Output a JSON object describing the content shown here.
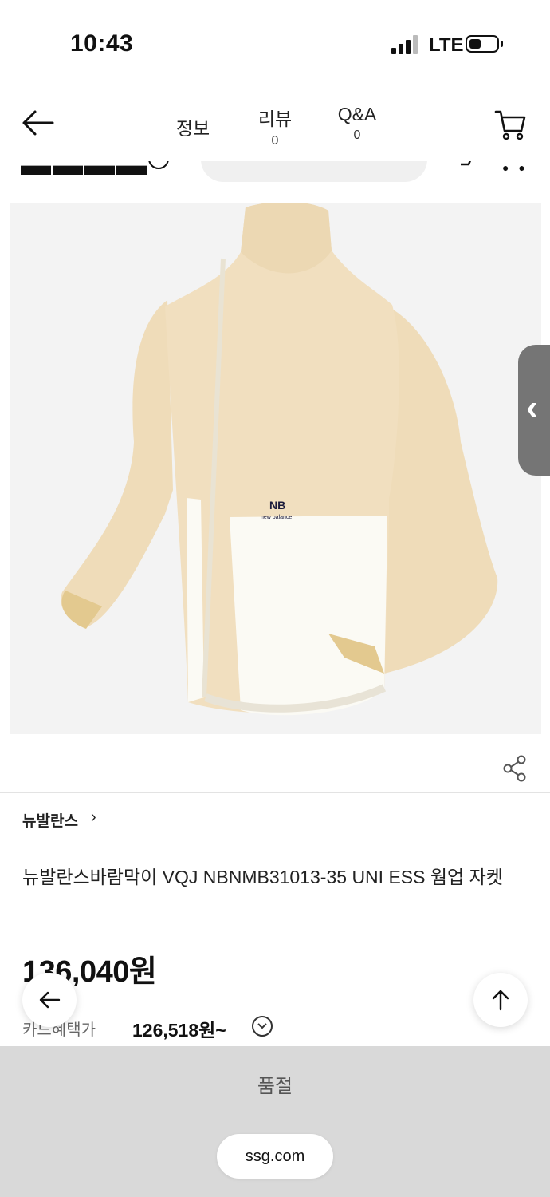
{
  "status_bar": {
    "time": "10:43",
    "network": "LTE"
  },
  "header": {
    "tabs": [
      {
        "label": "정보",
        "count": ""
      },
      {
        "label": "리뷰",
        "count": "0"
      },
      {
        "label": "Q&A",
        "count": "0"
      }
    ],
    "icons": {
      "back": "back-arrow-icon",
      "cart": "cart-icon"
    }
  },
  "product": {
    "brand": "뉴발란스",
    "title": "뉴발란스바람막이 VQJ NBNMB31013-35 UNI ESS 웜업 자켓",
    "price": "136,040원",
    "card_label": "카드혜택가",
    "card_price": "126,518원~",
    "image_colors": {
      "beige": "#f1dfbf",
      "white": "#fbfaf4",
      "background": "#f3f3f3"
    }
  },
  "actions": {
    "sold_out": "품절",
    "url": "ssg.com"
  },
  "colors": {
    "bottom_bar": "#d9d9d9",
    "side_handle": "#757575"
  }
}
